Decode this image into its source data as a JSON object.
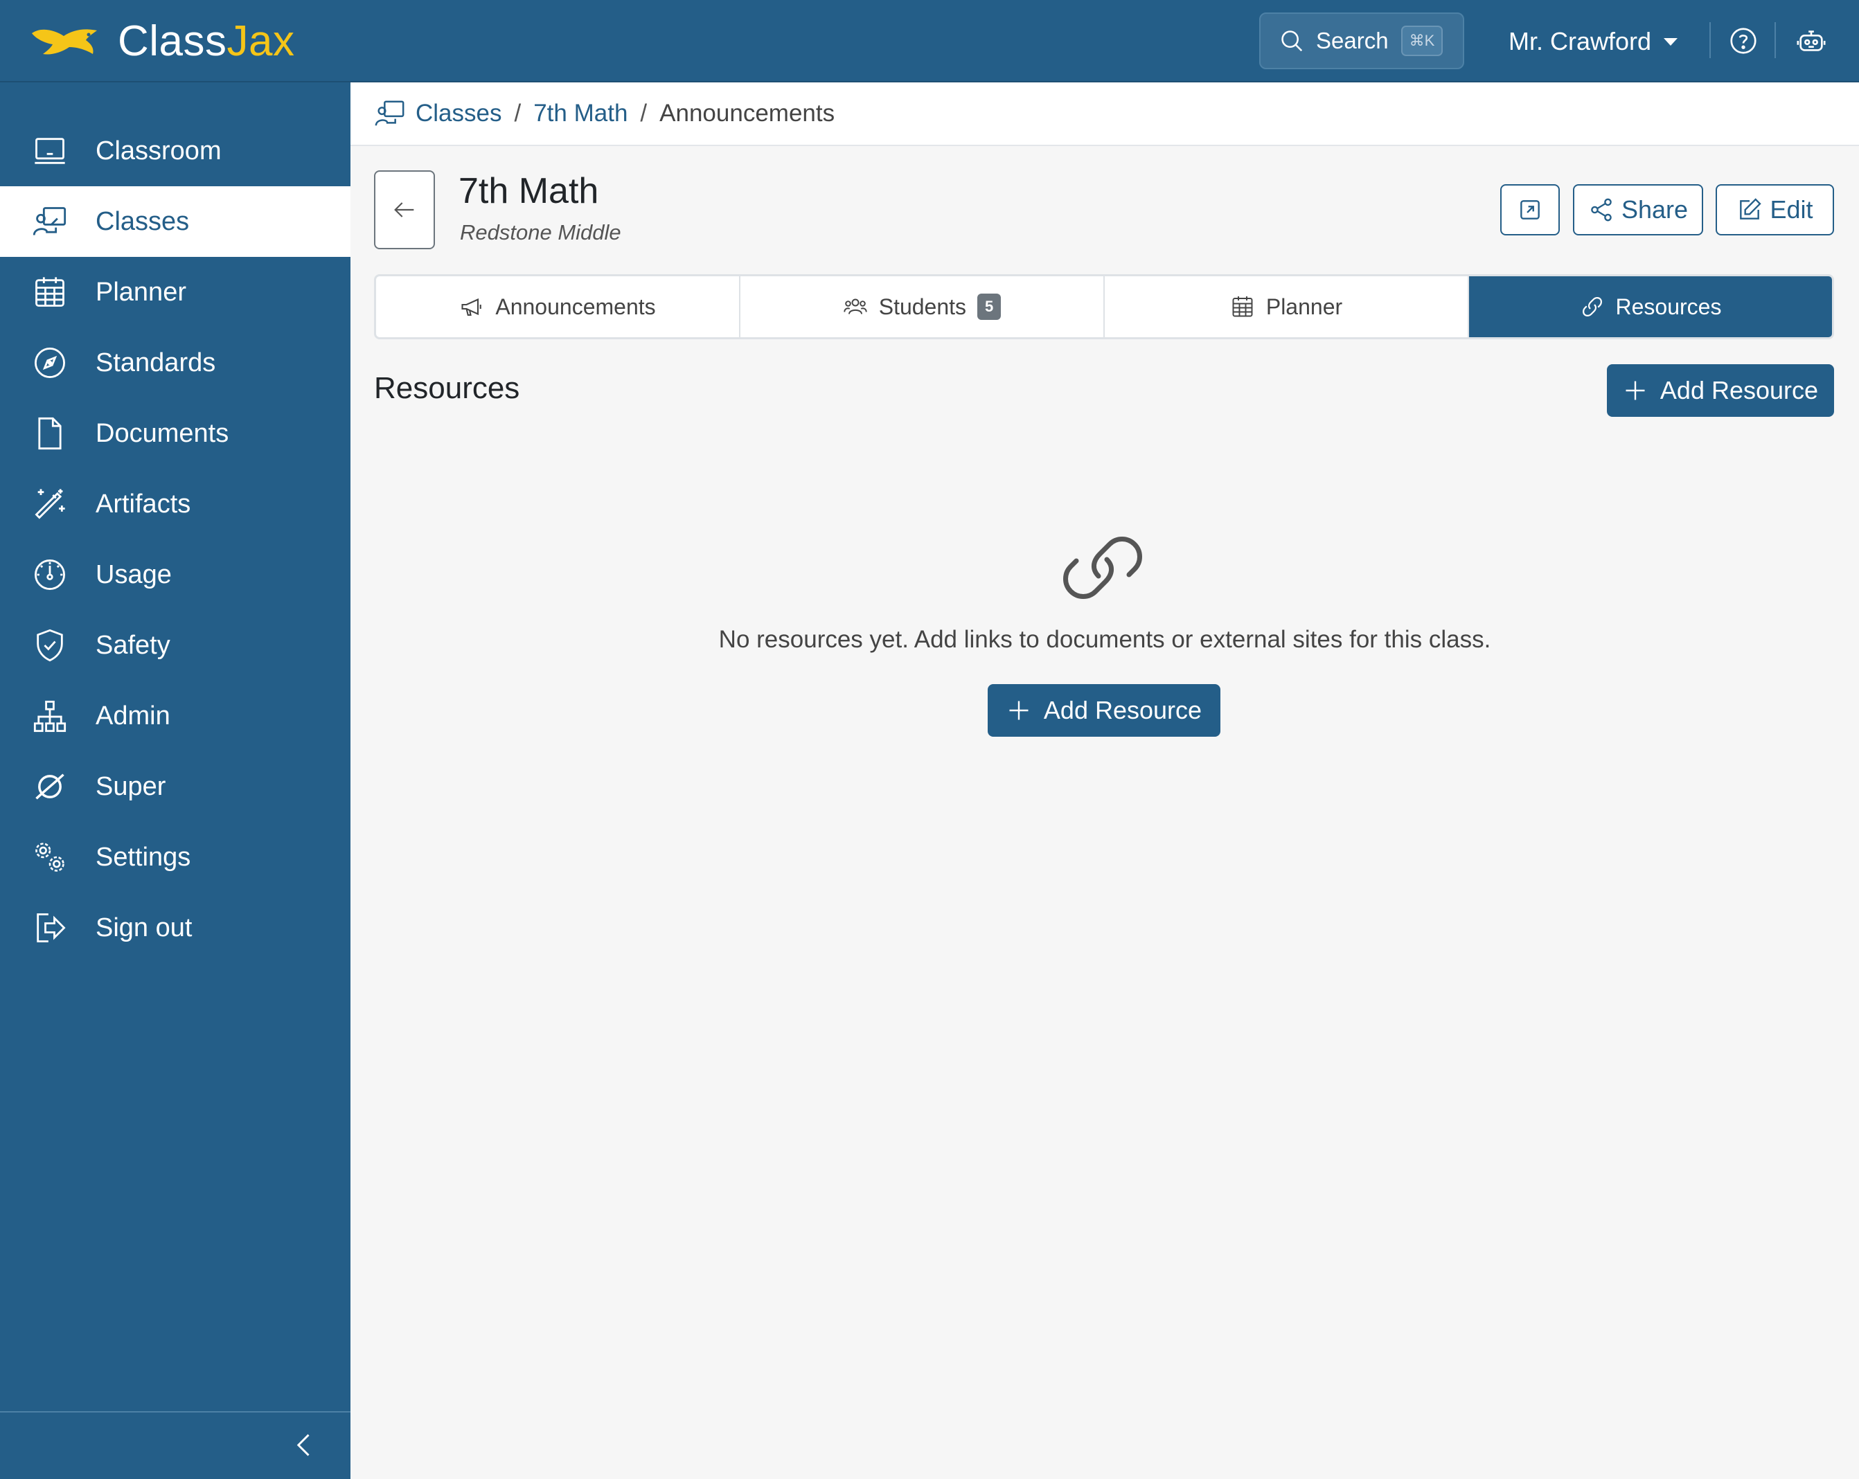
{
  "brand": {
    "name_main": "Class",
    "name_accent": "Jax",
    "accent_color": "#f5c518"
  },
  "topbar": {
    "search_label": "Search",
    "search_shortcut": "⌘K",
    "user_name": "Mr. Crawford"
  },
  "sidebar": {
    "items": [
      {
        "label": "Classroom",
        "icon": "monitor-icon"
      },
      {
        "label": "Classes",
        "icon": "teacher-board-icon",
        "active": true
      },
      {
        "label": "Planner",
        "icon": "calendar-grid-icon"
      },
      {
        "label": "Standards",
        "icon": "compass-icon"
      },
      {
        "label": "Documents",
        "icon": "document-icon"
      },
      {
        "label": "Artifacts",
        "icon": "magic-wand-icon"
      },
      {
        "label": "Usage",
        "icon": "gauge-icon"
      },
      {
        "label": "Safety",
        "icon": "shield-check-icon"
      },
      {
        "label": "Admin",
        "icon": "org-chart-icon"
      },
      {
        "label": "Super",
        "icon": "planet-icon"
      },
      {
        "label": "Settings",
        "icon": "gears-icon"
      },
      {
        "label": "Sign out",
        "icon": "sign-out-icon"
      }
    ]
  },
  "breadcrumb": {
    "items": [
      "Classes",
      "7th Math"
    ],
    "current": "Announcements",
    "separator": "/"
  },
  "class_header": {
    "title": "7th Math",
    "subtitle": "Redstone Middle",
    "share_label": "Share",
    "edit_label": "Edit"
  },
  "tabs": [
    {
      "label": "Announcements",
      "icon": "megaphone-icon"
    },
    {
      "label": "Students",
      "icon": "people-icon",
      "badge": "5"
    },
    {
      "label": "Planner",
      "icon": "calendar-icon"
    },
    {
      "label": "Resources",
      "icon": "link-icon",
      "active": true
    }
  ],
  "resources": {
    "title": "Resources",
    "add_label": "Add Resource",
    "empty_message": "No resources yet. Add links to documents or external sites for this class.",
    "empty_add_label": "Add Resource"
  },
  "colors": {
    "primary": "#245e88",
    "page_bg": "#f6f6f6",
    "badge": "#6c757d"
  }
}
